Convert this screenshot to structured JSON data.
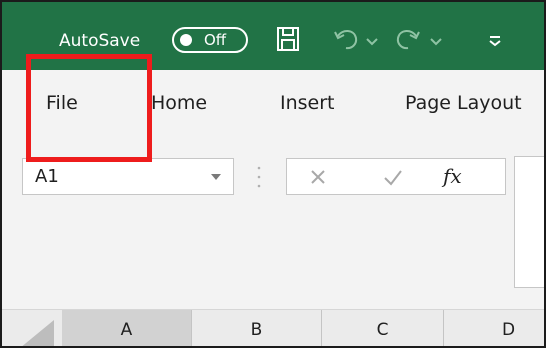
{
  "quick_access": {
    "autosave_label": "AutoSave",
    "autosave_state": "Off",
    "icons": [
      "save-icon",
      "undo-icon",
      "redo-icon",
      "customize-icon"
    ]
  },
  "ribbon": {
    "tabs": [
      {
        "label": "File"
      },
      {
        "label": "Home"
      },
      {
        "label": "Insert"
      },
      {
        "label": "Page Layout"
      }
    ]
  },
  "formula_bar": {
    "name_box_value": "A1",
    "fx_label": "fx"
  },
  "grid": {
    "columns": [
      "A",
      "B",
      "C",
      "D"
    ],
    "selected_column": "A"
  },
  "colors": {
    "title_bar": "#217346",
    "highlight": "#ee1c1c"
  }
}
